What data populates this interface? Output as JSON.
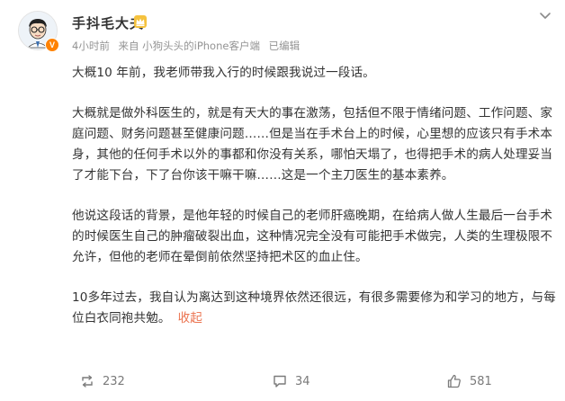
{
  "post": {
    "author": {
      "name": "手抖毛大夫",
      "avatar_icon": "cartoon-doctor-avatar",
      "verified_badge": "V",
      "crown_icon": "crown-badge-icon"
    },
    "meta": {
      "time": "4小时前",
      "source": "来自 小狗头头的iPhone客户端",
      "edited": "已编辑"
    },
    "content": {
      "paragraphs": [
        "大概10 年前，我老师带我入行的时候跟我说过一段话。",
        "大概就是做外科医生的，就是有天大的事在激荡，包括但不限于情绪问题、工作问题、家庭问题、财务问题甚至健康问题……但是当在手术台上的时候，心里想的应该只有手术本身，其他的任何手术以外的事都和你没有关系，哪怕天塌了，也得把手术的病人处理妥当了才能下台，下了台你该干嘛干嘛……这是一个主刀医生的基本素养。",
        "他说这段话的背景，是他年轻的时候自己的老师肝癌晚期，在给病人做人生最后一台手术的时候医生自己的肿瘤破裂出血，这种情况完全没有可能把手术做完，人类的生理极限不允许，但他的老师在晕倒前依然坚持把术区的血止住。",
        "10多年过去，我自认为离达到这种境界依然还很远，有很多需要修为和学习的地方，与每位白衣同袍共勉。"
      ],
      "collapse_label": "收起"
    },
    "actions": {
      "repost": {
        "count": "232",
        "icon": "repost-icon"
      },
      "comment": {
        "count": "34",
        "icon": "comment-icon"
      },
      "like": {
        "count": "581",
        "icon": "like-icon"
      }
    },
    "colors": {
      "text": "#333333",
      "meta": "#939393",
      "link": "#eb7350",
      "badge": "#ff8200"
    }
  }
}
